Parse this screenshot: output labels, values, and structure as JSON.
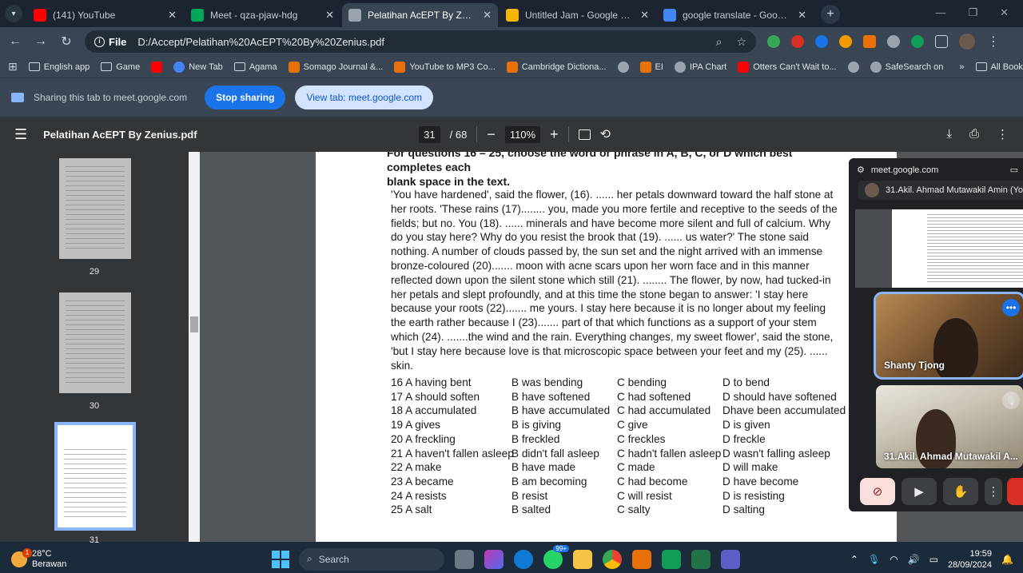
{
  "tabs": [
    {
      "title": "(141) YouTube",
      "icon": "youtube-icon",
      "color": "#ff0000",
      "active": false
    },
    {
      "title": "Meet - qza-pjaw-hdg",
      "icon": "meet-icon",
      "color": "#00a75a",
      "active": false
    },
    {
      "title": "Pelatihan AcEPT By Zenius",
      "icon": "globe-icon",
      "color": "#9aa3ad",
      "active": true
    },
    {
      "title": "Untitled Jam - Google Jamboard",
      "icon": "jamboard-icon",
      "color": "#f4b400",
      "active": false
    },
    {
      "title": "google translate - Google Search",
      "icon": "google-icon",
      "color": "#4285f4",
      "active": false
    }
  ],
  "address": {
    "chip": "File",
    "url": "D:/Accept/Pelatihan%20AcEPT%20By%20Zenius.pdf"
  },
  "bookmarks": [
    {
      "label": "English app",
      "type": "folder"
    },
    {
      "label": "Game",
      "type": "folder"
    },
    {
      "label": "",
      "type": "youtube"
    },
    {
      "label": "New Tab",
      "type": "google"
    },
    {
      "label": "Agama",
      "type": "folder"
    },
    {
      "label": "Somago Journal &...",
      "type": "site"
    },
    {
      "label": "YouTube to MP3 Co...",
      "type": "site"
    },
    {
      "label": "Cambridge Dictiona...",
      "type": "site"
    },
    {
      "label": "",
      "type": "globe"
    },
    {
      "label": "EI",
      "type": "site"
    },
    {
      "label": "IPA Chart",
      "type": "globe"
    },
    {
      "label": "Otters Can't Wait to...",
      "type": "youtube"
    },
    {
      "label": "",
      "type": "globe"
    },
    {
      "label": "SafeSearch on",
      "type": "globe"
    }
  ],
  "bookmarks_right": "All Bookmarks",
  "share": {
    "text": "Sharing this tab to meet.google.com",
    "stop": "Stop sharing",
    "view": "View tab: meet.google.com"
  },
  "pdf": {
    "title": "Pelatihan AcEPT By Zenius.pdf",
    "page": "31",
    "total": "/ 68",
    "zoom": "110%",
    "thumb_labels": [
      "29",
      "30",
      "31"
    ],
    "heading_partial": "For questions 16 – 25, choose the word or phrase in A, B, C, or D which best completes each",
    "heading_line2": "blank space in the text.",
    "passage": "'You have hardened', said the flower, (16). ...... her petals downward toward the half stone at her roots. 'These rains (17)........ you, made you more fertile and receptive to the seeds of the fields; but no. You (18). ...... minerals and have become more silent and full of calcium. Why do you stay here? Why do you resist the brook that (19). ...... us water?' The stone said nothing. A number of clouds passed by, the sun set and the night arrived with an immense bronze-coloured (20)....... moon with acne scars upon her worn face and in this manner reflected down upon the silent stone which still (21). ........ The flower, by now, had tucked-in her petals and slept profoundly, and at this time the stone began to answer: 'I stay here because your roots (22)....... me yours. I stay here because it is no longer about my feeling the earth rather because I (23)....... part of that which functions as a support of your stem which (24). .......the wind and the rain. Everything changes, my sweet flower', said the stone, 'but I stay here because love is that microscopic space between your feet and my (25). ...... skin.",
    "options": [
      [
        "16 A having bent",
        "B was bending",
        "C bending",
        "D to bend"
      ],
      [
        "17 A should soften",
        "B have softened",
        "C had softened",
        "D should have softened"
      ],
      [
        "18 A accumulated",
        "B have accumulated",
        "C had accumulated",
        "Dhave been accumulated"
      ],
      [
        "19 A gives",
        "B is giving",
        "C give",
        "D is given"
      ],
      [
        "20 A freckling",
        "B freckled",
        "C freckles",
        "D freckle"
      ],
      [
        "21 A haven't fallen asleep",
        "B didn't fall asleep",
        "C hadn't fallen asleep",
        "D wasn't falling asleep"
      ],
      [
        "22 A make",
        "B have made",
        "C made",
        "D will make"
      ],
      [
        "23 A became",
        "B am becoming",
        "C had become",
        "D have become"
      ],
      [
        "24 A resists",
        "B resist",
        "C will resist",
        "D is resisting"
      ],
      [
        "25 A salt",
        "B salted",
        "C salty",
        "D salting"
      ]
    ]
  },
  "meet": {
    "url": "meet.google.com",
    "presenter": "31.Akil. Ahmad Mutawakil Amin (Yo...",
    "tile1_name": "Shanty Tjong",
    "tile2_name": "31.Akil. Ahmad Mutawakil A..."
  },
  "taskbar": {
    "temp": "28°C",
    "weather": "Berawan",
    "weather_badge": "1",
    "search": "Search",
    "whatsapp_badge": "99+",
    "time": "19:59",
    "date": "28/09/2024"
  }
}
